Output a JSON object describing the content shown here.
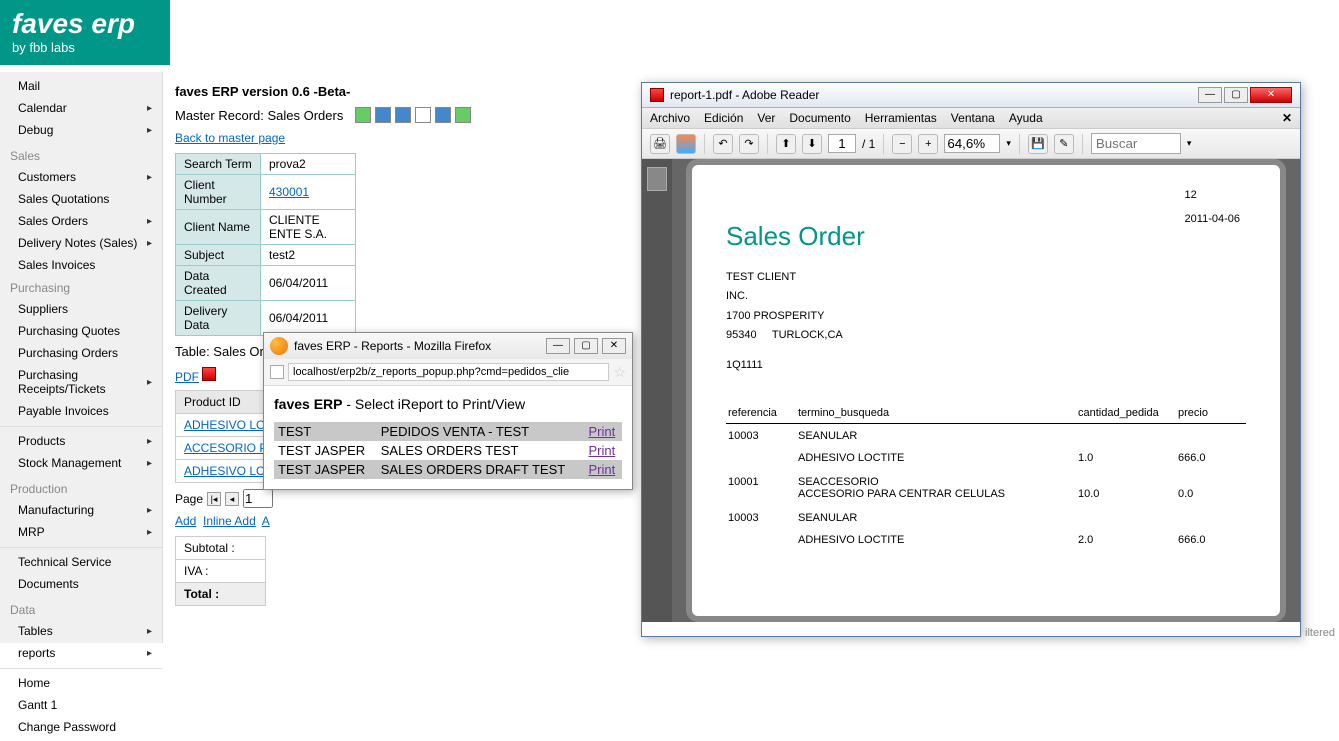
{
  "logo": {
    "brand": "faves erp",
    "byline": "by fbb labs"
  },
  "sidebar": {
    "top": [
      "Mail",
      "Calendar",
      "Debug"
    ],
    "sales_heading": "Sales",
    "sales": [
      "Customers",
      "Sales Quotations",
      "Sales Orders",
      "Delivery Notes (Sales)",
      "Sales Invoices"
    ],
    "purchasing_heading": "Purchasing",
    "purchasing": [
      "Suppliers",
      "Purchasing Quotes",
      "Purchasing Orders",
      "Purchasing Receipts/Tickets",
      "Payable Invoices"
    ],
    "inv": [
      "Products",
      "Stock Management"
    ],
    "production_heading": "Production",
    "production": [
      "Manufacturing",
      "MRP"
    ],
    "misc": [
      "Technical Service",
      "Documents"
    ],
    "data_heading": "Data",
    "data": [
      "Tables",
      "reports"
    ],
    "bottom": [
      "Home",
      "Gantt 1",
      "Change Password"
    ]
  },
  "version_title": "faves ERP version 0.6 -Beta-",
  "master_title": "Master Record: Sales Orders",
  "back_link": "Back to master page",
  "record": {
    "labels": [
      "Search Term",
      "Client Number",
      "Client Name",
      "Subject",
      "Data Created",
      "Delivery Data"
    ],
    "values": [
      "prova2",
      "430001",
      "CLIENTE ENTE S.A.",
      "test2",
      "06/04/2011",
      "06/04/2011"
    ]
  },
  "details_title": "Table: Sales Orders Details",
  "pdf_label": "PDF",
  "details_header": "Product ID",
  "details_rows": [
    "ADHESIVO LOCTITE",
    "ACCESORIO PARA",
    "ADHESIVO LOCTITE"
  ],
  "pager": {
    "label": "Page",
    "value": "1",
    "add": "Add",
    "inline": "Inline Add",
    "a": "A"
  },
  "summary": [
    "Subtotal :",
    "IVA :",
    "Total :"
  ],
  "firefox": {
    "title": "faves ERP - Reports - Mozilla Firefox",
    "url": "localhost/erp2b/z_reports_popup.php?cmd=pedidos_clie",
    "heading_bold": "faves ERP",
    "heading_rest": " - Select iReport to Print/View",
    "rows": [
      {
        "c1": "TEST",
        "c2": "PEDIDOS VENTA - TEST",
        "c3": "Print"
      },
      {
        "c1": "TEST JASPER",
        "c2": "SALES ORDERS TEST",
        "c3": "Print"
      },
      {
        "c1": "TEST JASPER",
        "c2": "SALES ORDERS DRAFT TEST",
        "c3": "Print"
      }
    ]
  },
  "adobe": {
    "title": "report-1.pdf - Adobe Reader",
    "menu": [
      "Archivo",
      "Edición",
      "Ver",
      "Documento",
      "Herramientas",
      "Ventana",
      "Ayuda"
    ],
    "page_current": "1",
    "page_total": "/  1",
    "zoom": "64,6%",
    "search_placeholder": "Buscar",
    "doc": {
      "num": "12",
      "date": "2011-04-06",
      "title": "Sales Order",
      "addr1": "TEST CLIENT",
      "addr2": "INC.",
      "addr3": "1700 PROSPERITY",
      "zip": "95340",
      "city": "TURLOCK,CA",
      "ref": "1Q1111",
      "headers": [
        "referencia",
        "termino_busqueda",
        "cantidad_pedida",
        "precio"
      ],
      "lines": [
        {
          "ref": "10003",
          "term1": "SEANULAR",
          "term2": "ADHESIVO LOCTITE",
          "qty": "1.0",
          "price": "666.0"
        },
        {
          "ref": "10001",
          "term1": "SEACCESORIO",
          "term2": "ACCESORIO PARA CENTRAR CELULAS",
          "qty": "10.0",
          "price": "0.0"
        },
        {
          "ref": "10003",
          "term1": "SEANULAR",
          "term2": "ADHESIVO LOCTITE",
          "qty": "2.0",
          "price": "666.0"
        }
      ]
    }
  },
  "filtered": "iltered"
}
